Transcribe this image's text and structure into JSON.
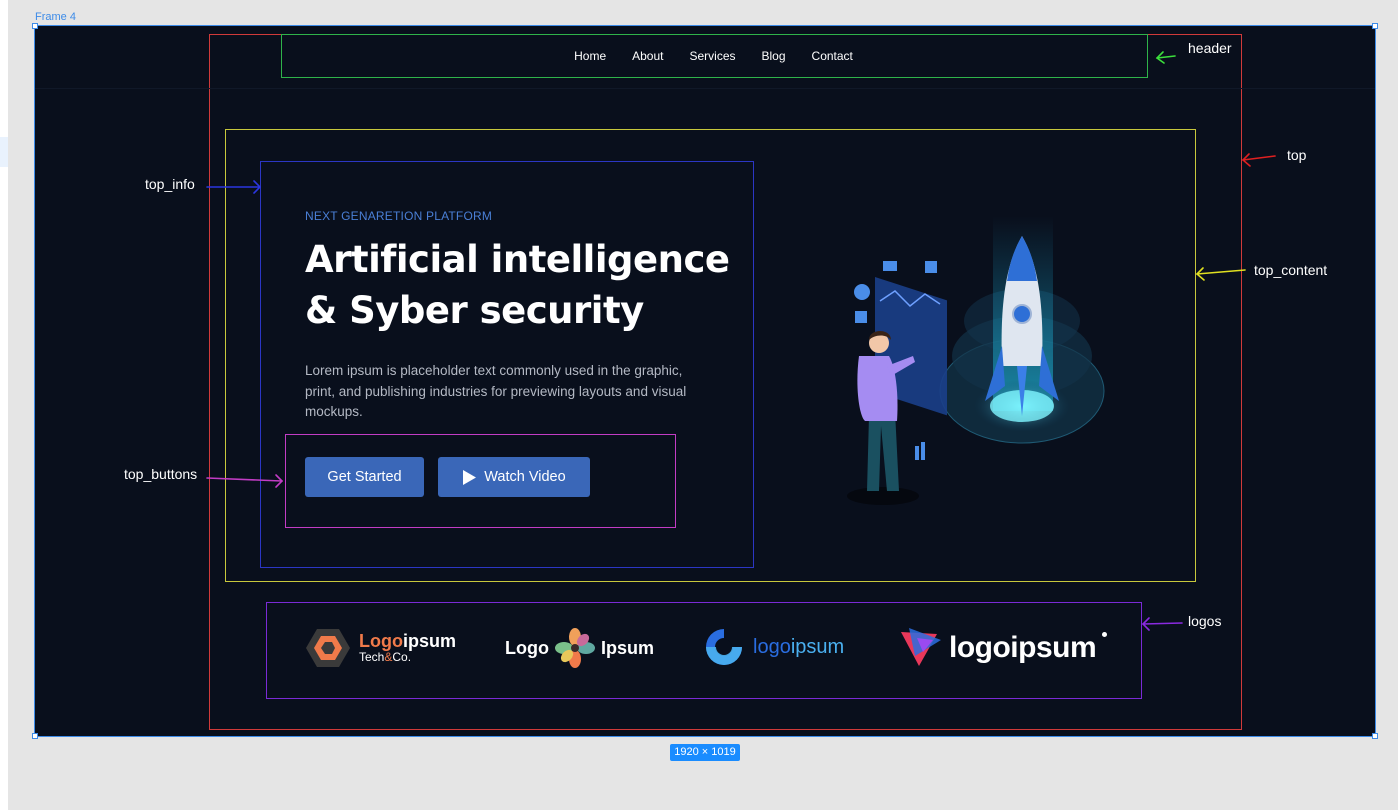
{
  "canvas": {
    "frame_label": "Frame 4",
    "size_badge": "1920 × 1019"
  },
  "header": {
    "nav": [
      "Home",
      "About",
      "Services",
      "Blog",
      "Contact"
    ]
  },
  "hero": {
    "eyebrow": "NEXT GENARETION PLATFORM",
    "title_line1": "Artificial intelligence",
    "title_line2": "& Syber security",
    "description": "Lorem ipsum is placeholder text commonly used in the graphic, print, and publishing industries for previewing layouts and visual mockups.",
    "primary_button": "Get Started",
    "secondary_button": "Watch Video",
    "secondary_icon": "play-icon",
    "illustration": "rocket-launch-illustration"
  },
  "logos": [
    {
      "part1": "Logo",
      "part2": "ipsum",
      "sub_a": "Tech",
      "sub_amp": "&",
      "sub_b": "Co."
    },
    {
      "left": "Logo",
      "right": "Ipsum"
    },
    {
      "part1": "logo",
      "part2": "ipsum"
    },
    {
      "text": "logoipsum"
    }
  ],
  "annotations": {
    "header": "header",
    "top": "top",
    "top_content": "top_content",
    "top_info": "top_info",
    "top_buttons": "top_buttons",
    "logos": "logos"
  },
  "colors": {
    "frame_bg": "#090f1c",
    "accent": "#3a67b8",
    "eyebrow": "#4a7fd6",
    "header_box": "#2fb34a",
    "top_box": "#d03a3a",
    "content_box": "#c8c83c",
    "info_box": "#2b36c4",
    "buttons_box": "#c23cc4",
    "logos_box": "#7a2ad6",
    "selection": "#3d8be8"
  }
}
